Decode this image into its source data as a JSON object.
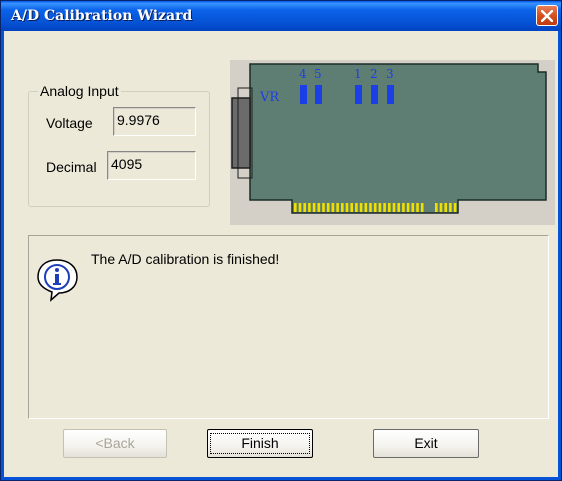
{
  "window": {
    "title": "A/D Calibration Wizard",
    "close_icon": "close-icon"
  },
  "analog_input": {
    "group_label": "Analog Input",
    "voltage_label": "Voltage",
    "voltage_value": "9.9976",
    "decimal_label": "Decimal",
    "decimal_value": "4095"
  },
  "board": {
    "labels": [
      "4",
      "5",
      "1",
      "2",
      "3"
    ],
    "vr_label": "VR",
    "colors": {
      "pcb": "#5f7e73",
      "jumper": "#1a3fe6",
      "pins": "#f0e000"
    }
  },
  "message": {
    "icon": "info-icon",
    "text": "The A/D calibration is finished!"
  },
  "buttons": {
    "back": "<Back",
    "finish": "Finish",
    "exit": "Exit"
  }
}
